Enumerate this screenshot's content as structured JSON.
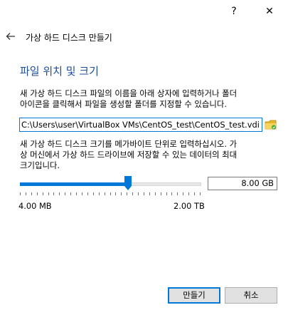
{
  "window": {
    "help_glyph": "?",
    "close_glyph": "✕"
  },
  "header": {
    "title": "가상 하드 디스크 만들기"
  },
  "section": {
    "title": "파일 위치 및 크기"
  },
  "location": {
    "desc_lines": [
      "새 가상 하드 디스크 파일의 이름을 아래 상자에 입력하거나 폴더",
      "아이콘을 클릭해서 파일을 생성할 폴더를 지정할 수 있습니다."
    ],
    "path_value": "C:\\Users\\user\\VirtualBox VMs\\CentOS_test\\CentOS_test.vdi"
  },
  "size": {
    "desc_lines": [
      "새 가상 하드 디스크 크기를 메가바이트 단위로 입력하십시오. 가",
      "상 머신에서 가상 하드 드라이브에 저장할 수 있는 데이터의 최대",
      "크기입니다."
    ],
    "value_text": "8.00 GB",
    "min_label": "4.00 MB",
    "max_label": "2.00 TB",
    "slider_fraction": 0.6
  },
  "buttons": {
    "create": "만들기",
    "cancel": "취소"
  },
  "colors": {
    "accent": "#0078d7",
    "title": "#1c4e9b"
  }
}
